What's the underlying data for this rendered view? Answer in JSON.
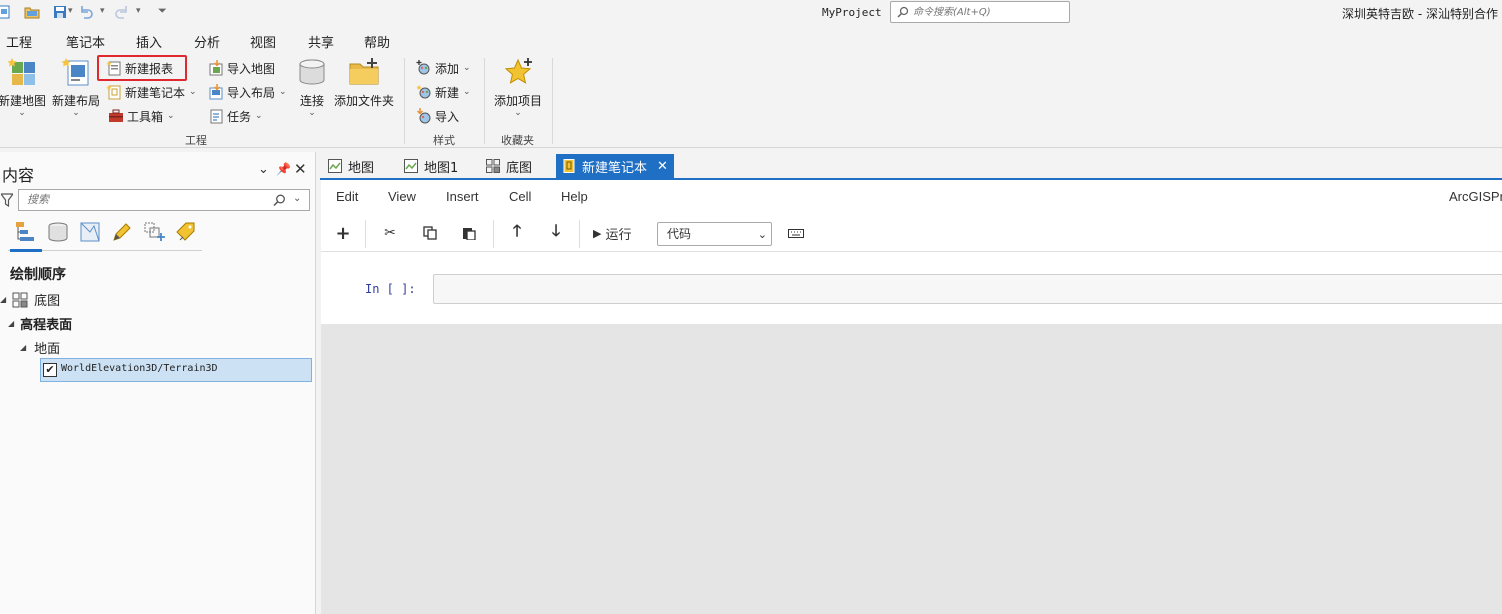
{
  "titlebar": {
    "project_name": "MyProject",
    "search_placeholder": "命令搜索(Alt+Q)",
    "window_title": "深圳英特吉欧 - 深汕特别合作"
  },
  "ribbon_tabs": [
    "工程",
    "笔记本",
    "插入",
    "分析",
    "视图",
    "共享",
    "帮助"
  ],
  "ribbon_active_tab": "插入",
  "ribbon": {
    "project_group": {
      "new_map": "新建地图",
      "new_layout": "新建布局",
      "new_report": "新建报表",
      "new_notebook": "新建笔记本",
      "toolbox": "工具箱",
      "import_map": "导入地图",
      "import_layout": "导入布局",
      "task": "任务",
      "connect": "连接",
      "add_folder": "添加文件夹",
      "label": "工程"
    },
    "style_group": {
      "add": "添加",
      "new": "新建",
      "import": "导入",
      "label": "样式"
    },
    "favorites_group": {
      "add_item": "添加项目",
      "label": "收藏夹"
    }
  },
  "contents": {
    "title": "内容",
    "search_placeholder": "搜索",
    "draw_order": "绘制顺序",
    "tree": {
      "basemap": "底图",
      "elevation_surfaces": "高程表面",
      "ground": "地面",
      "layer": "WorldElevation3D/Terrain3D"
    }
  },
  "doc_tabs": [
    {
      "label": "地图",
      "active": false
    },
    {
      "label": "地图1",
      "active": false
    },
    {
      "label": "底图",
      "active": false
    },
    {
      "label": "新建笔记本",
      "active": true
    }
  ],
  "notebook": {
    "menus": [
      "Edit",
      "View",
      "Insert",
      "Cell",
      "Help"
    ],
    "brand": "ArcGISPr",
    "run_label": "运行",
    "cell_type": "代码",
    "cell_prompt": "In [ ]:"
  },
  "colors": {
    "accent": "#1f6fc5",
    "highlight": "#e0292f",
    "selection": "#cce2f4"
  }
}
